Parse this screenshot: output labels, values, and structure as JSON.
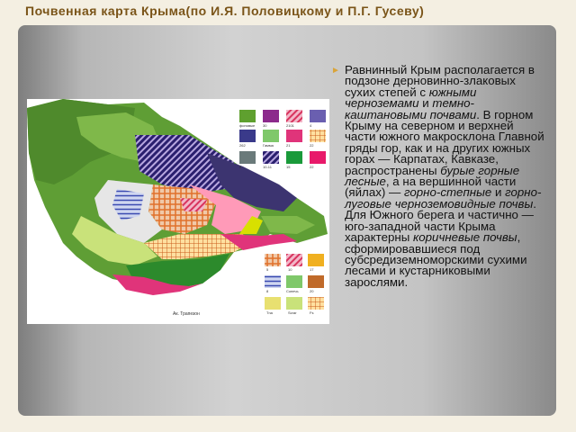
{
  "slide": {
    "title": "Почвенная карта Крыма(по И.Я. Половицкому  и П.Г. Гусеву)"
  },
  "map": {
    "place_label": "Ак. Трапезон",
    "legend_top": [
      "фонoвые",
      "30",
      "2101",
      "4",
      "262",
      "Гамма",
      "21",
      "22",
      "8",
      "10-11",
      "15",
      "22"
    ],
    "legend_bottom": [
      "5",
      "10",
      "17",
      "8",
      "Coпечь",
      "20",
      "Tna",
      "Scrar",
      "Fs"
    ]
  },
  "body_text": {
    "t1": "Равнинный Крым располагается в подзоне дерновинно-злаковых сухих степей с ",
    "e1": "южными черноземами",
    "t2": " и ",
    "e2": "темно-каштановыми почвами",
    "t3": ". В горном Крыму на северном и верхней части южного макросклона Главной гряды гор, как и на других южных горах — Карпатах, Кавказе, распространены ",
    "e3": "бурые горные лесные",
    "t4": ", а на вершинной части (яйлах) — ",
    "e4": "горно-степные",
    "t5": " и ",
    "e5": "горно-луговые черноземовидные почвы",
    "t6": ". Для Южного берега и частично — юго-западной части Крыма характерны ",
    "e6": "коричневые почвы",
    "t7": ", сформировавшиеся под субсредиземноморскими сухими лесами и кустарниковыми зарослями."
  }
}
